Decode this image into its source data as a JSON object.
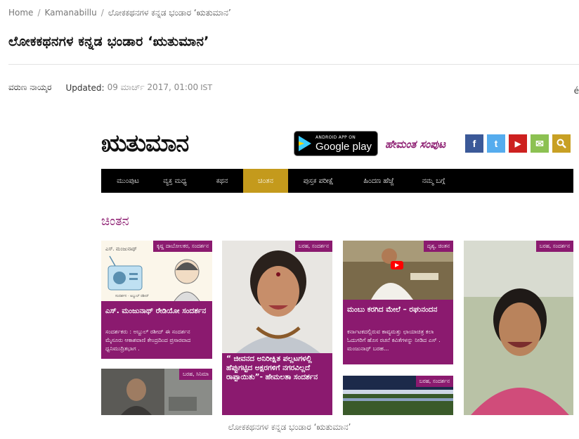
{
  "breadcrumb": {
    "home": "Home",
    "section": "Kamanabillu",
    "current": "ಲೋಕಕಥನಗಳ ಕನ್ನಡ ಭಂಡಾರ ‘ಋತುಮಾನ’"
  },
  "article": {
    "title": "ಲೋಕಕಥನಗಳ ಕನ್ನಡ ಭಂಡಾರ ‘ಋತುಮಾನ’",
    "author": "ವರುಣ ನಾಯ್ಕರ",
    "updated_label": "Updated:",
    "updated_value": "09 ಮಾರ್ಚ್ 2017, 01:00",
    "timezone": "IST",
    "edge_char": "é"
  },
  "figure": {
    "caption": "ಲೋಕಕಥನಗಳ ಕನ್ನಡ ಭಂಡಾರ ‘ಋತುಮಾನ’",
    "site": {
      "logo": "ಋತುಮಾನ",
      "google_play_small": "ANDROID APP ON",
      "google_play_big": "Google play",
      "supplement": "ಹೇಮಂತ ಸಂಪುಟ",
      "social": [
        {
          "icon": "facebook-icon",
          "glyph": "f",
          "color": "#3b5998"
        },
        {
          "icon": "twitter-icon",
          "glyph": "t",
          "color": "#55acee"
        },
        {
          "icon": "youtube-icon",
          "glyph": "▶",
          "color": "#cd201f"
        },
        {
          "icon": "email-icon",
          "glyph": "✉",
          "color": "#8cc152"
        },
        {
          "icon": "search-icon",
          "glyph": "⚲",
          "color": "#c8a024"
        }
      ],
      "nav": [
        "ಮುಂಪುಟ",
        "ವ್ಯಕ್ತ ಮಧ್ಯ",
        "ಕಥನ",
        "ಚಿಂತನ",
        "ಪುಸ್ತಕ ಪರೀಕ್ಷೆ",
        "ಹಿಂದಣ ಹೆಜ್ಜೆ",
        "ನಮ್ಮ ಬಗ್ಗೆ"
      ],
      "active_nav": "ಚಿಂತನ",
      "section_title": "ಚಿಂತನ",
      "cards": [
        {
          "tag": "ಕೃಷ್ಣ ದಾಬೋಲಕರ, ಸಂದರ್ಶನ",
          "title": "ಎಸ್. ಮಂಜುನಾಥ್ ರೇಡಿಯೋ ಸಂದರ್ಶನ",
          "text": "ಸಂದರ್ಶಕರು : ಅಬ್ದುಲ್ ರಶೀದ್ ಈ ಸಂದರ್ಶನ ಮೈಸೂರು ಆಕಾಶವಾಣಿ ಕೇಂದ್ರದಿಂದ ಪ್ರಸಾರವಾದ ಧ್ವನಿಮುದ್ರಿತಭಾಗ ."
        },
        {
          "tag": "ಬರಹ, ಸಂದರ್ಶನ",
          "title": "“ ಜೀವನದ ಅನಿರೀಕ್ಷಿತ ಪಲ್ಲಟಗಳಲ್ಲಿ ಹೆಪ್ಪುಗಟ್ಟಿದ ಅಕ್ಷರಗಳಿಗೆ ನಗರವಿಲ್ಲದೆ ರಾಪ್ಪಾಯಿತು”- ಹೇಮಲತಾ ಸಂದರ್ಶನ",
          "text": ""
        },
        {
          "tag": "ದೃಶ್ಯ, ಚಿಂತನ",
          "title": "ಮಂಬು ಕರಗಿದ ಮೇಲೆ – ರಘುನಂದನ",
          "text": "ಕರ್ನಾಟಕದಲ್ಲಿರುವ ಕಾವ್ಯಮತ್ತು ಛಾಯಾಚಿತ್ರ ಕಲಾ ಓದುಗರಿಗೆ ಹೊಸ ರಚನೆ ಕವಿತೆಗಳನ್ನು ನೀಡಿದ ಎಸ್ . ಮಂಜುನಾಥ್ ಬರಹ..."
        },
        {
          "tag": "ಬರಹ, ಸಂದರ್ಶನ",
          "title": "",
          "text": ""
        },
        {
          "tag": "ಬರಹ, ಸಿನಿಮಾ",
          "title": "",
          "text": ""
        },
        {
          "tag": "ಬರಹ, ಸಂದರ್ಶನ",
          "title": "",
          "text": ""
        }
      ]
    }
  }
}
